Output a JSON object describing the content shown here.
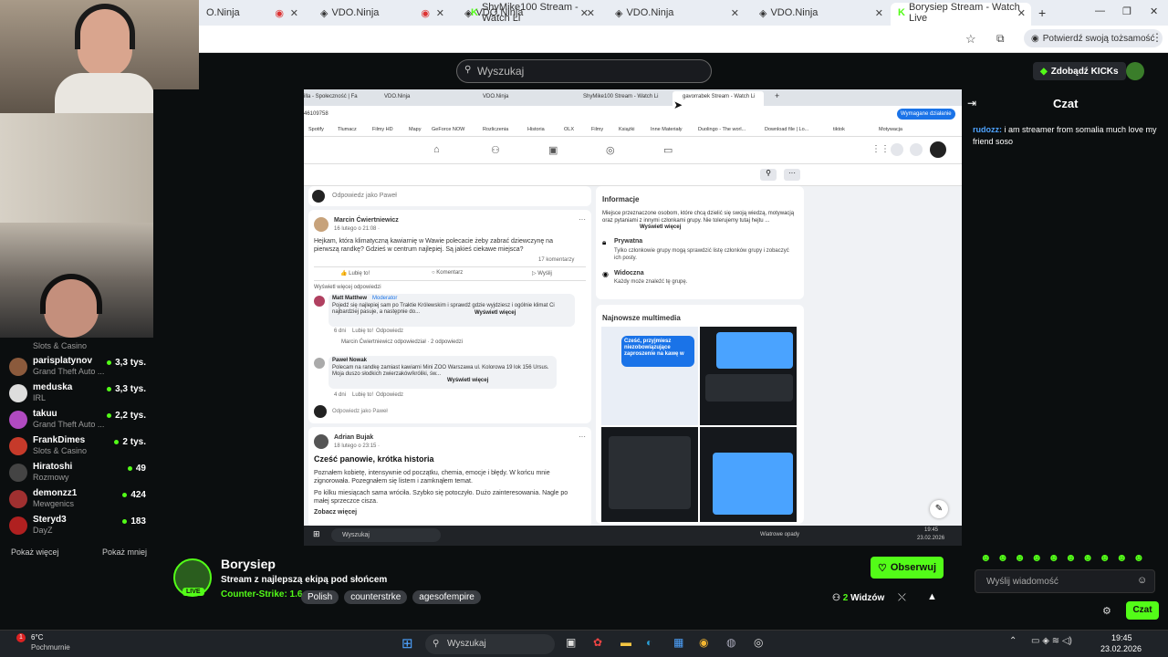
{
  "browser": {
    "tabs": [
      {
        "label": "O.Ninja"
      },
      {
        "label": "VDO.Ninja"
      },
      {
        "label": "VDO.Ninja"
      },
      {
        "label": "ShyMike100 Stream - Watch Li"
      },
      {
        "label": "VDO.Ninja"
      },
      {
        "label": "VDO.Ninja"
      },
      {
        "label": "Borysiep Stream - Watch Live"
      }
    ],
    "profile_button": "Potwierdź swoją tożsamość"
  },
  "kick": {
    "search_placeholder": "Wyszukaj",
    "kicks_button": "Zdobądź KICKs",
    "chat_title": "Czat",
    "show_more": "Pokaż więcej",
    "show_less": "Pokaż mniej",
    "channels": [
      {
        "name": "",
        "category": "Slots & Casino",
        "viewers": "",
        "color": "#7a5a3a"
      },
      {
        "name": "parisplatynov",
        "category": "Grand Theft Auto ...",
        "viewers": "3,3 tys.",
        "color": "#8b5a3c"
      },
      {
        "name": "meduska",
        "category": "IRL",
        "viewers": "3,3 tys.",
        "color": "#ddd"
      },
      {
        "name": "takuu",
        "category": "Grand Theft Auto ...",
        "viewers": "2,2 tys.",
        "color": "#b04ac0"
      },
      {
        "name": "FrankDimes",
        "category": "Slots & Casino",
        "viewers": "2 tys.",
        "color": "#c63a2a"
      },
      {
        "name": "Hiratoshi",
        "category": "Rozmowy",
        "viewers": "49",
        "color": "#444"
      },
      {
        "name": "demonzz1",
        "category": "Mewgenics",
        "viewers": "424",
        "color": "#a03030"
      },
      {
        "name": "Steryd3",
        "category": "DayZ",
        "viewers": "183",
        "color": "#b02020"
      }
    ],
    "chat_message": {
      "user": "rudozz:",
      "text": "i am streamer from somalia much love my friend soso"
    },
    "chat_input_placeholder": "Wyślij wiadomość",
    "chat_send": "Czat",
    "streamer": {
      "name": "Borysiep",
      "title": "Stream z najlepszą ekipą pod słońcem",
      "game": "Counter-Strike: 1.6",
      "tags": [
        "Polish",
        "counterstrke",
        "agesofempire"
      ],
      "live": "LIVE",
      "follow": "Obserwuj",
      "viewers": "2",
      "viewers_label": "Widzów"
    }
  },
  "inner": {
    "tabs": [
      "illa - Społeczność | Fa",
      "VDO.Ninja",
      "VDO.Ninja",
      "ShyMike100 Stream - Watch Li",
      "gavorrabek Stream - Watch Li"
    ],
    "address": "46109758",
    "bookmarks": [
      "Spotify",
      "Tłumacz",
      "Filmy HD",
      "Mapy",
      "GeForce NOW",
      "Rozliczenia",
      "Historia",
      "OLX",
      "Filmy",
      "Książki",
      "Inne Materiały",
      "Duolingo - The worl...",
      "Download file | Lo...",
      "tiktok",
      "Motywacja"
    ],
    "update_button": "Wymagane działanie",
    "reply_as": "Odpowiedz jako Paweł",
    "post1": {
      "author": "Marcin Ćwiertniewicz",
      "date": "16 lutego o 21:08 · ",
      "text": "Hejkam, która klimatyczną kawiarnię w Wawie polecacie żeby zabrać dziewczynę na pierwszą randkę? Gdzieś w centrum najlepiej. Są jakieś ciekawe miejsca?",
      "comments_count": "17 komentarzy",
      "like": "Lubię to!",
      "comment": "Komentarz",
      "share": "Wyślij",
      "more_replies": "Wyświetl więcej odpowiedzi",
      "reply1_author": "Matt Matthew",
      "reply1_role": "Moderator",
      "reply1_text": "Pojedź się najlepiej sam po Traktie Królewskim i sprawdź gdzie wyjdziesz i ogólnie klimat Ci najbardziej pasuje, a następnie do...",
      "reply1_more": "Wyświetl więcej",
      "reply1_time": "6 dni",
      "reply1_like": "Lubię to!",
      "reply1_reply": "Odpowiedz",
      "reply1_sub": "Marcin Ćwiertniewicz odpowiedział · 2 odpowiedzi",
      "reply2_author": "Paweł Nowak",
      "reply2_text": "Polecam na randkę zamiast kawiarni Mini ZOO Warszawa ul. Kolorowa 19 lok 156 Ursus. Moja duszo słodkich zwierzaków/króliki, św...",
      "reply2_more": "Wyświetl więcej",
      "reply2_time": "4 dni",
      "reply2_like": "Lubię to!",
      "reply2_reply": "Odpowiedz"
    },
    "post2": {
      "author": "Adrian Bujak",
      "date": "18 lutego o 23:15 · ",
      "title": "Cześć panowie, krótka historia",
      "text1": "Poznałem kobietę, intensywnie od początku, chemia, emocje i błędy. W końcu mnie zignorowała. Pozegnałem się listem i zamknąłem temat.",
      "text2": "Po kilku miesiącach sama wróciła. Szybko się potoczyło. Dużo zainteresowania. Nagle po małej sprzeczce cisza.",
      "see_more": "Zobacz więcej"
    },
    "info": {
      "title": "Informacje",
      "text": "Miejsce przeznaczone osobom, które chcą dzielić się swoją wiedzą, motywacją oraz pytaniami z innymi członkami grupy. Nie tolerujemy tutaj hejtu ...",
      "more": "Wyświetl więcej",
      "private_title": "Prywatna",
      "private_text": "Tylko członkowie grupy mogą sprawdzić listę członków grupy i zobaczyć ich posty.",
      "visible_title": "Widoczna",
      "visible_text": "Każdy może znaleźć tę grupę."
    },
    "media_title": "Najnowsze multimedia",
    "media_caption": "Cześć, przyjmiesz niezobowiązujące zaproszenie na kawę w",
    "taskbar_search": "Wyszukaj",
    "weather_alert": "Wiatrowe opady",
    "clock_time": "19:45",
    "clock_date": "23.02.2026"
  },
  "taskbar": {
    "weather_temp": "6°C",
    "weather_text": "Pochmurnie",
    "search": "Wyszukaj",
    "time": "19:45",
    "date": "23.02.2026"
  }
}
